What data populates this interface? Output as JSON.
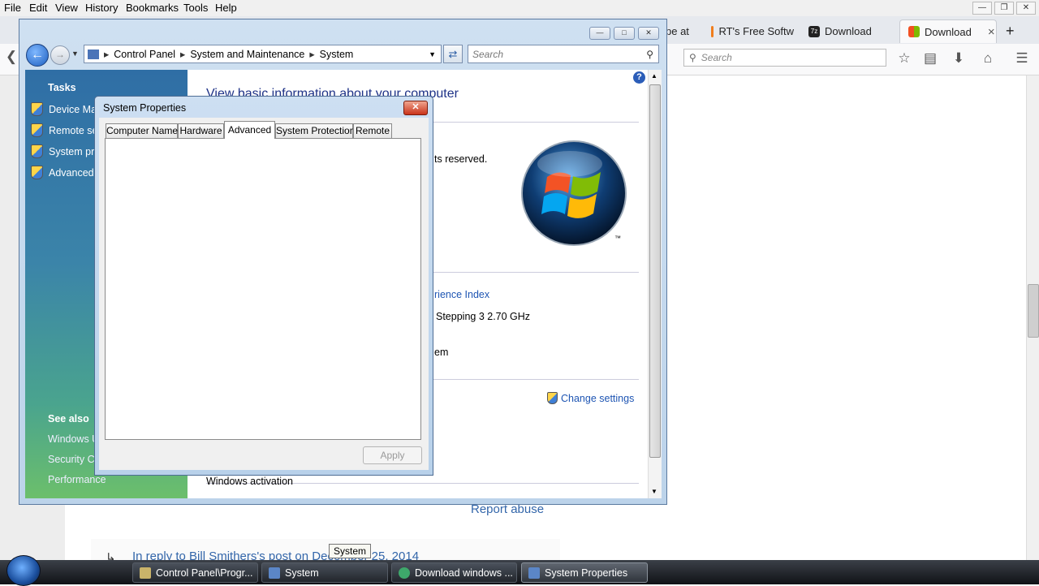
{
  "firefox": {
    "menu": [
      "File",
      "Edit",
      "View",
      "History",
      "Bookmarks",
      "Tools",
      "Help"
    ],
    "tabs": [
      {
        "label": "pe at"
      },
      {
        "label": "RT's Free Softw"
      },
      {
        "label": "Download"
      },
      {
        "label": "Download",
        "close": "×",
        "active": true
      }
    ],
    "new_tab": "+",
    "search_placeholder": "Search",
    "page": {
      "report_abuse": "Report abuse",
      "reply_link": "In reply to Bill Smithers's post on December 25, 2014"
    }
  },
  "control_panel": {
    "breadcrumb": [
      "Control Panel",
      "System and Maintenance",
      "System"
    ],
    "search_placeholder": "Search",
    "tasks_heading": "Tasks",
    "tasks": [
      "Device Ma",
      "Remote se",
      "System pro",
      "Advanced"
    ],
    "see_also_heading": "See also",
    "see_also": [
      "Windows U",
      "Security Ce",
      "Performance"
    ],
    "heading": "View basic information about your computer",
    "fragments": {
      "rights": "ts reserved.",
      "experience_index": "rience Index",
      "processor": "Stepping 3   2.70 GHz",
      "system_type": "em",
      "change_settings": "Change settings",
      "windows_activation": "Windows activation"
    }
  },
  "system_properties": {
    "title": "System Properties",
    "close": "✕",
    "tabs": [
      "Computer Name",
      "Hardware",
      "Advanced",
      "System Protection",
      "Remote"
    ],
    "active_tab": "Advanced",
    "apply": "Apply"
  },
  "taskbar": {
    "tooltip": "System",
    "buttons": [
      {
        "label": "Control Panel\\Progr..."
      },
      {
        "label": "System"
      },
      {
        "label": "Download windows ..."
      },
      {
        "label": "System Properties",
        "active": true
      }
    ]
  }
}
